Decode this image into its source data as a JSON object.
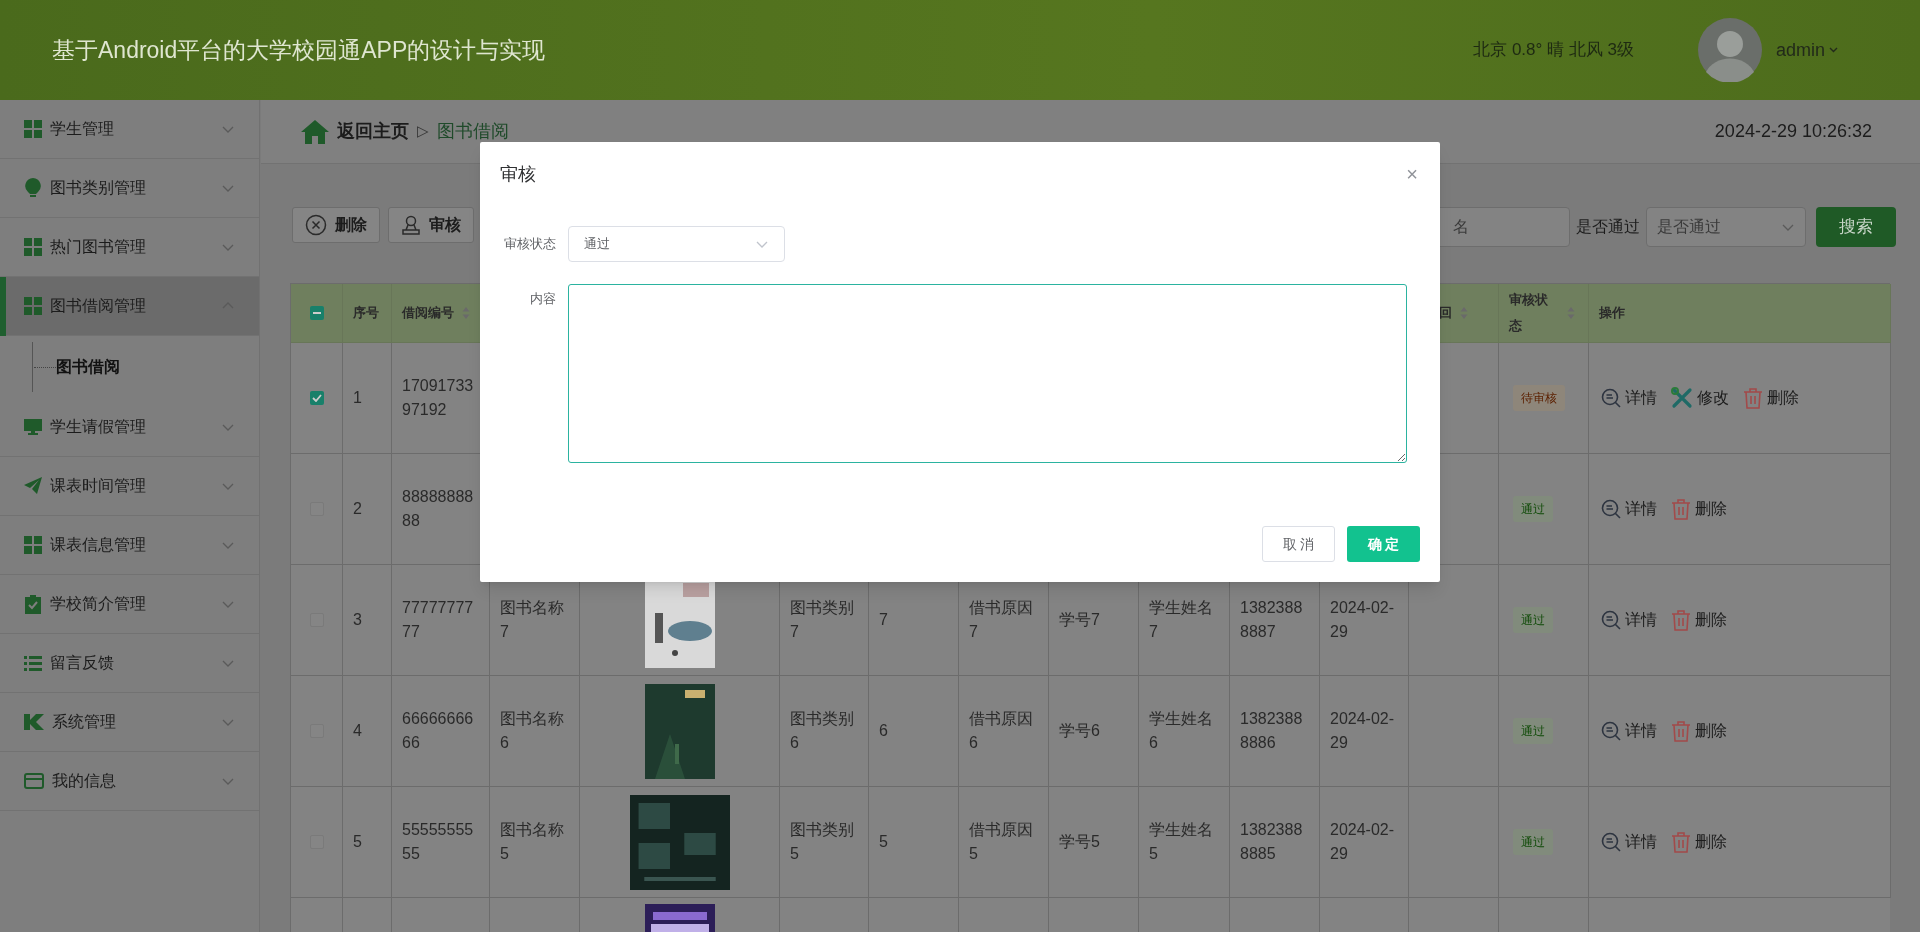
{
  "header": {
    "title": "基于Android平台的大学校园通APP的设计与实现",
    "weather": "北京 0.8° 晴 北风 3级",
    "user": "admin"
  },
  "sidebar": {
    "items": [
      {
        "label": "学生管理",
        "expanded": false,
        "selected": false
      },
      {
        "label": "图书类别管理",
        "expanded": false,
        "selected": false
      },
      {
        "label": "热门图书管理",
        "expanded": false,
        "selected": false
      },
      {
        "label": "图书借阅管理",
        "expanded": true,
        "selected": true,
        "children": [
          {
            "label": "图书借阅",
            "selected": true
          }
        ]
      },
      {
        "label": "学生请假管理",
        "expanded": false,
        "selected": false
      },
      {
        "label": "课表时间管理",
        "expanded": false,
        "selected": false
      },
      {
        "label": "课表信息管理",
        "expanded": false,
        "selected": false
      },
      {
        "label": "学校简介管理",
        "expanded": false,
        "selected": false
      },
      {
        "label": "留言反馈",
        "expanded": false,
        "selected": false
      },
      {
        "label": "系统管理",
        "expanded": false,
        "selected": false
      },
      {
        "label": "我的信息",
        "expanded": false,
        "selected": false
      }
    ]
  },
  "breadcrumb": {
    "home": "返回主页",
    "separator": "▷",
    "current": "图书借阅"
  },
  "datetime": "2024-2-29 10:26:32",
  "toolbar": {
    "buttons": [
      {
        "label": "删除",
        "kind": "delete"
      },
      {
        "label": "审核",
        "kind": "review"
      }
    ],
    "name_search": {
      "placeholder": "名"
    },
    "pass_filter": {
      "label": "是否通过",
      "placeholder": "是否通过"
    },
    "search_button": "搜索"
  },
  "table": {
    "select_all_partial": true,
    "columns": [
      {
        "label": "序号",
        "sortable": false
      },
      {
        "label": "借阅编号",
        "sortable": true
      },
      {
        "label": "回",
        "sortable": true
      },
      {
        "label": "审核状态",
        "sortable": true
      },
      {
        "label": "操作",
        "sortable": false
      }
    ],
    "rows": [
      {
        "checked": true,
        "index": "1",
        "borrow_no": "1709173397192",
        "status": {
          "label": "待审核",
          "kind": "pending"
        },
        "actions": [
          {
            "label": "详情",
            "kind": "detail"
          },
          {
            "label": "修改",
            "kind": "edit"
          },
          {
            "label": "删除",
            "kind": "delete"
          }
        ]
      },
      {
        "checked": false,
        "index": "2",
        "borrow_no": "8888888888",
        "status": {
          "label": "通过",
          "kind": "passed"
        },
        "actions": [
          {
            "label": "详情",
            "kind": "detail"
          },
          {
            "label": "删除",
            "kind": "delete"
          }
        ]
      },
      {
        "checked": false,
        "index": "3",
        "borrow_no": "7777777777",
        "book_name": "图书名称7",
        "cover": {
          "kind": "picture"
        },
        "category": "图书类别7",
        "column_7": "7",
        "reason": "借书原因7",
        "student_no": "学号7",
        "student_name": "学生姓名7",
        "phone": "13823888887",
        "date": "2024-02-29",
        "status": {
          "label": "通过",
          "kind": "passed"
        },
        "actions": [
          {
            "label": "详情",
            "kind": "detail"
          },
          {
            "label": "删除",
            "kind": "delete"
          }
        ]
      },
      {
        "checked": false,
        "index": "4",
        "borrow_no": "6666666666",
        "book_name": "图书名称6",
        "cover": {
          "kind": "picture"
        },
        "category": "图书类别6",
        "column_7": "6",
        "reason": "借书原因6",
        "student_no": "学号6",
        "student_name": "学生姓名6",
        "phone": "13823888886",
        "date": "2024-02-29",
        "status": {
          "label": "通过",
          "kind": "passed"
        },
        "actions": [
          {
            "label": "详情",
            "kind": "detail"
          },
          {
            "label": "删除",
            "kind": "delete"
          }
        ]
      },
      {
        "checked": false,
        "index": "5",
        "borrow_no": "5555555555",
        "book_name": "图书名称5",
        "cover": {
          "kind": "picture"
        },
        "category": "图书类别5",
        "column_7": "5",
        "reason": "借书原因5",
        "student_no": "学号5",
        "student_name": "学生姓名5",
        "phone": "13823888885",
        "date": "2024-02-29",
        "status": {
          "label": "通过",
          "kind": "passed"
        },
        "actions": [
          {
            "label": "详情",
            "kind": "detail"
          },
          {
            "label": "删除",
            "kind": "delete"
          }
        ]
      },
      {
        "cover": {
          "kind": "picture"
        }
      }
    ]
  },
  "dialog": {
    "title": "审核",
    "close": "×",
    "fields": [
      {
        "kind": "select",
        "label": "审核状态",
        "value": "通过"
      },
      {
        "kind": "textarea",
        "label": "内容",
        "focused": true
      }
    ],
    "buttons": [
      {
        "label": "取 消",
        "kind": "default"
      },
      {
        "label": "确 定",
        "kind": "primary"
      }
    ]
  }
}
